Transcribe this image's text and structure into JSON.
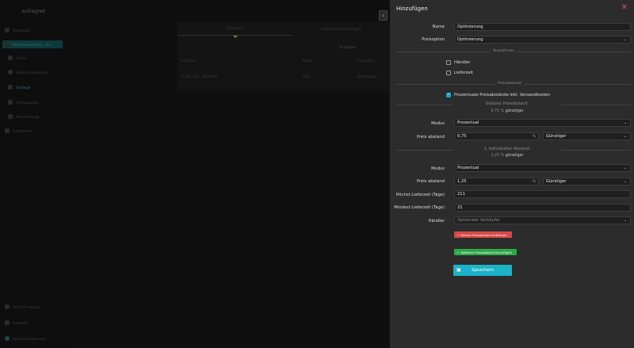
{
  "background": {
    "logo": "ecDagnet",
    "sidebar_items": [
      "Dashboard",
      "Marktbeobachtung - Ko...",
      "Artikel",
      "Bestandsverwaltung",
      "Strategie",
      "Auftragsbeleg",
      "Preiserhebung",
      "Schnittstelle"
    ],
    "sidebar_footer": [
      "Hilfe & Feedback",
      "Anmelden",
      "bellemoderaktiv.com"
    ],
    "tabs": [
      "Strategien",
      "Automatische Preisregeln"
    ],
    "table_title": "Strategien",
    "table_headers": [
      "Sortierbar",
      "Name",
      "Preisoption"
    ],
    "table_row": [
      "05.08.2020 · 10:20 Uhr",
      "Opti",
      "Optimierung"
    ]
  },
  "drawer": {
    "title": "Hinzufügen",
    "name_label": "Name",
    "name_value": "Optimierung",
    "preisoption_label": "Preisoption",
    "preisoption_value": "Optimierung",
    "section_ausnahmen": "Ausnahmen",
    "cb_haendler": "Händler",
    "cb_lieferzeit": "Lieferzeit",
    "section_preisabstand": "Preisabstand",
    "cb_prozentuale": "Prozentuale Preisabstände inkl. Versandkosten",
    "global_title": "Globaler Preisabstand:",
    "global_value": "0,75 %",
    "global_suffix": "günstiger",
    "modus_label": "Modus",
    "modus_value": "Prozentual",
    "preis_label": "Preis abstand",
    "preis_value_1": "0,75",
    "unit": "%",
    "direction_1": "Günstiger",
    "indiv_title": "1. Individueller Abstand:",
    "indiv_value": "1,25 %",
    "indiv_suffix": "günstiger",
    "modus_value_2": "Prozentual",
    "preis_value_2": "1,25",
    "direction_2": "Günstiger",
    "hoechst_label": "Höchst Lieferzeit (Tage)",
    "hoechst_value": "211",
    "mindest_label": "Mindest Lieferzeit (Tage)",
    "mindest_value": "21",
    "haendler_label": "Händler",
    "haendler_placeholder": "Optionaler Verkäufer",
    "remove_button": "Diesen Preisabstand entfernen",
    "add_button": "Weiteren Preisabstand hinzufügen",
    "save_button": "Speichern"
  },
  "colors": {
    "accent": "#1bb3c8",
    "danger": "#d94848",
    "success": "#2fa84a",
    "close": "#e24b4b"
  }
}
